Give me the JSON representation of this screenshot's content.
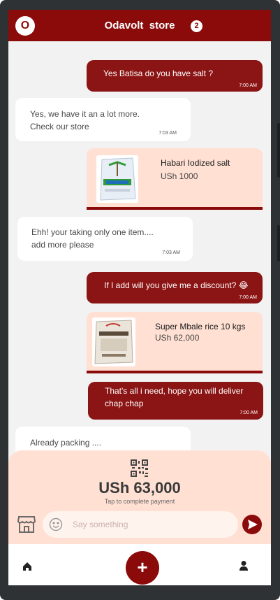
{
  "header": {
    "avatar_letter": "O",
    "title": "Odavolt  store",
    "badge_count": "2"
  },
  "messages": [
    {
      "text": "Yes Batisa do you have salt ?",
      "time": "7:00 AM"
    },
    {
      "text": "Yes, we have it an a lot more.\nCheck our  store",
      "time": "7:03 AM"
    },
    {
      "product_name": "Habari Iodized salt",
      "product_price": "USh 1000"
    },
    {
      "text": "Ehh! your taking only one item....\nadd more please",
      "time": "7:03 AM"
    },
    {
      "text": "If I add will you give me a discount? 😂",
      "time": "7:00 AM"
    },
    {
      "product_name": "Super Mbale rice 10  kgs",
      "product_price": "USh 62,000"
    },
    {
      "text": "That's all i need, hope you will deliver\nchap chap",
      "time": "7:00 AM"
    },
    {
      "text": "Already packing ...."
    }
  ],
  "payment": {
    "total": "USh 63,000",
    "hint": "Tap to complete payment"
  },
  "composer": {
    "placeholder": "Say something"
  },
  "nav": {
    "add_label": "+"
  },
  "icons": [
    "qr-code-icon",
    "store-icon",
    "emoji-icon",
    "send-icon",
    "home-icon",
    "add-icon",
    "user-icon"
  ],
  "colors": {
    "brand": "#8b0a0a",
    "outgoing_bubble": "#8b1414",
    "product_card": "#ffe0d3",
    "panel": "#ffe0d3"
  }
}
